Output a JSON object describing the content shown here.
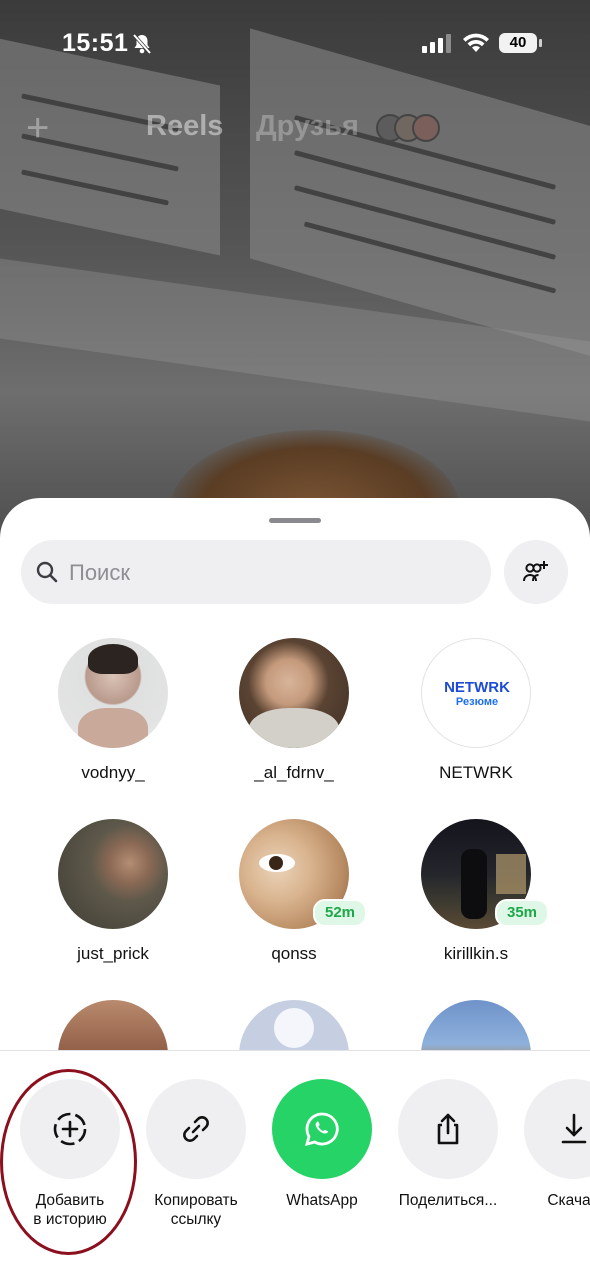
{
  "status_bar": {
    "time": "15:51",
    "battery": "40"
  },
  "top_nav": {
    "tabs": [
      "Reels",
      "Друзья"
    ]
  },
  "share_sheet": {
    "search": {
      "placeholder": "Поиск"
    },
    "contacts": [
      {
        "name": "vodnyy_"
      },
      {
        "name": "_al_fdrnv_"
      },
      {
        "name": "NETWRK",
        "logo_text": "NETWRK",
        "logo_sub": "Резюме"
      },
      {
        "name": "just_prick"
      },
      {
        "name": "qonss",
        "active_badge": "52m"
      },
      {
        "name": "kirillkin.s",
        "active_badge": "35m"
      }
    ],
    "actions": [
      {
        "line1": "Добавить",
        "line2": "в историю"
      },
      {
        "line1": "Копировать",
        "line2": "ссылку"
      },
      {
        "line1": "WhatsApp",
        "line2": ""
      },
      {
        "line1": "Поделиться...",
        "line2": ""
      },
      {
        "line1": "Скача",
        "line2": ""
      }
    ]
  },
  "colors": {
    "whatsapp": "#25d366",
    "active_badge_text": "#1ea84a",
    "highlight_ring": "#8b0f1d"
  }
}
